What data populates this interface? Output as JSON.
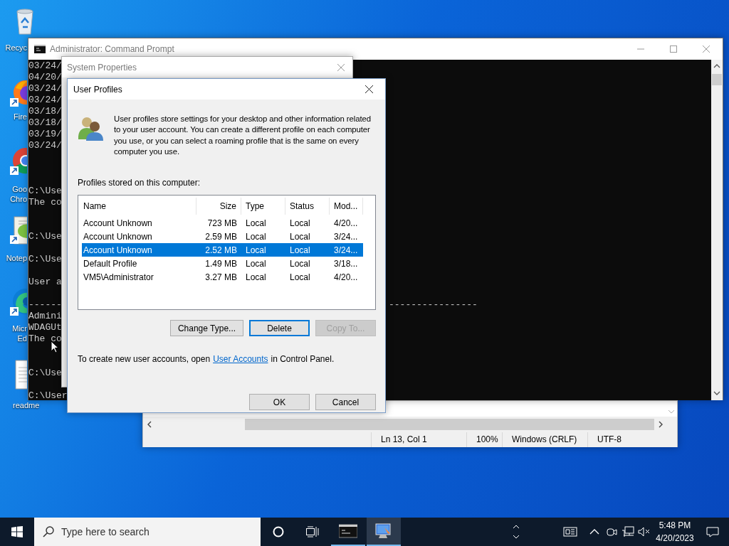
{
  "desktop_icons": [
    {
      "kind": "recycle",
      "label": "Recyc"
    },
    {
      "kind": "firefox",
      "label": "Fire"
    },
    {
      "kind": "chrome",
      "label": "Goo\nChro"
    },
    {
      "kind": "notepad",
      "label": "Notep"
    },
    {
      "kind": "edge",
      "label": "Micr\nEd"
    },
    {
      "kind": "document",
      "label": "readme"
    }
  ],
  "cmd_window": {
    "title": "Administrator: Command Prompt",
    "blocks": [
      [
        "03/24/",
        "04/20/",
        "03/24/",
        "03/24/",
        "03/18/",
        "03/18/",
        "03/19/",
        "03/24/"
      ],
      [
        "C:\\Use",
        "The co"
      ],
      [
        "C:\\Use"
      ],
      [
        "C:\\Use"
      ],
      [
        "User a"
      ],
      [
        "------",
        "Admini",
        "WDAGUt",
        "The co"
      ],
      [
        "C:\\Use"
      ],
      [
        "C:\\User"
      ]
    ],
    "dash_line": "----------------"
  },
  "system_properties": {
    "title": "System Properties"
  },
  "user_profiles": {
    "title": "User Profiles",
    "description": "User profiles store settings for your desktop and other information related to your user account. You can create a different profile on each computer you use, or you can select a roaming profile that is the same on every computer you use.",
    "list_label": "Profiles stored on this computer:",
    "columns": [
      "Name",
      "Size",
      "Type",
      "Status",
      "Mod..."
    ],
    "rows": [
      {
        "cells": [
          "Account Unknown",
          "723 MB",
          "Local",
          "Local",
          "4/20..."
        ],
        "selected": false
      },
      {
        "cells": [
          "Account Unknown",
          "2.59 MB",
          "Local",
          "Local",
          "3/24..."
        ],
        "selected": false
      },
      {
        "cells": [
          "Account Unknown",
          "2.52 MB",
          "Local",
          "Local",
          "3/24..."
        ],
        "selected": true
      },
      {
        "cells": [
          "Default Profile",
          "1.49 MB",
          "Local",
          "Local",
          "3/18..."
        ],
        "selected": false
      },
      {
        "cells": [
          "VM5\\Administrator",
          "3.27 MB",
          "Local",
          "Local",
          "4/20..."
        ],
        "selected": false
      }
    ],
    "buttons": [
      {
        "label": "Change Type...",
        "disabled": false,
        "focused": false
      },
      {
        "label": "Delete",
        "disabled": false,
        "focused": true
      },
      {
        "label": "Copy To...",
        "disabled": true,
        "focused": false
      }
    ],
    "footer_before": "To create new user accounts, open",
    "footer_link": "User Accounts",
    "footer_after": "in Control Panel.",
    "dialog_buttons": [
      "OK",
      "Cancel"
    ]
  },
  "notepad": {
    "status": [
      "Ln 13, Col 1",
      "100%",
      "Windows (CRLF)",
      "UTF-8"
    ]
  },
  "taskbar": {
    "search_placeholder": "Type here to search",
    "apps": [
      {
        "kind": "terminal",
        "selected": false
      },
      {
        "kind": "system",
        "selected": true
      }
    ],
    "time": "5:48 PM",
    "date": "4/20/2023"
  }
}
